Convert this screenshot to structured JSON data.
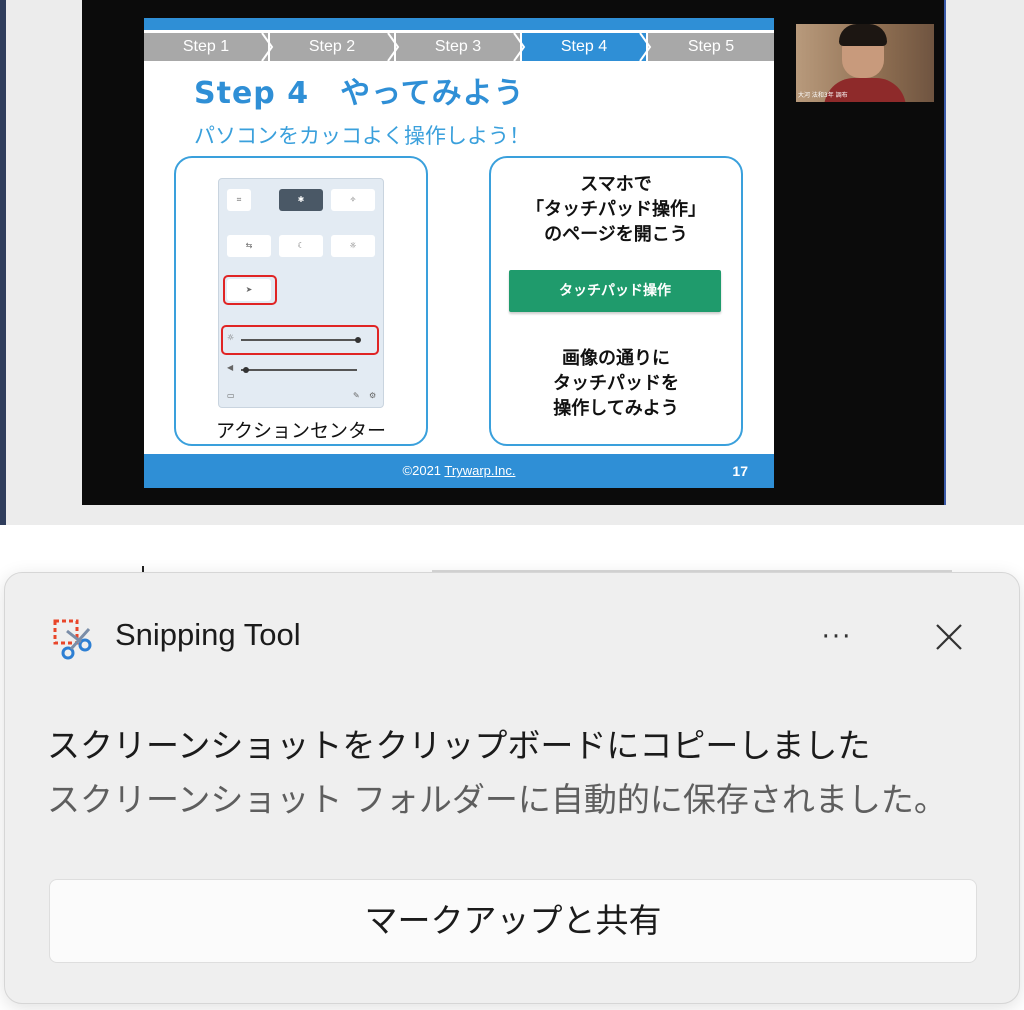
{
  "slide": {
    "steps": [
      "Step 1",
      "Step 2",
      "Step 3",
      "Step 4",
      "Step 5"
    ],
    "active_step_index": 3,
    "title": "Step 4　やってみよう",
    "subtitle": "パソコンをカッコよく操作しよう！",
    "left_panel_label": "アクションセンター",
    "right_panel_text_1": "スマホで\n「タッチパッド操作」\nのページを開こう",
    "right_panel_button": "タッチパッド操作",
    "right_panel_text_2": "画像の通りに\nタッチパッドを\n操作してみよう",
    "footer_copyright": "©2021 ",
    "footer_company": "Trywarp.Inc.",
    "page_number": "17"
  },
  "participant": {
    "name_tag": "大河 法和3年 調布"
  },
  "toast": {
    "app_name": "Snipping Tool",
    "more_label": "···",
    "title": "スクリーンショットをクリップボードにコピーしました",
    "body": "スクリーンショット フォルダーに自動的に保存されました。",
    "action_button": "マークアップと共有"
  },
  "colors": {
    "slide_accent": "#2f8fd6",
    "slide_button": "#1f9b6c",
    "highlight_red": "#e02424",
    "toast_background": "#efefef"
  },
  "icons": {
    "app_icon": "snipping-tool-icon",
    "more_icon": "more-options-icon",
    "close_icon": "close-icon"
  }
}
